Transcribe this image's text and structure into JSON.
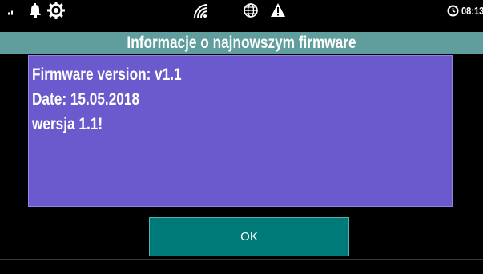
{
  "status_bar": {
    "time": "08:13",
    "icons": [
      "signal-dots-icon",
      "bell-icon",
      "gear-icon",
      "wifi-icon",
      "globe-icon",
      "warning-icon",
      "clock-icon"
    ]
  },
  "dialog": {
    "title": "Informacje o najnowszym firmware",
    "lines": [
      "Firmware version: v1.1",
      "Date: 15.05.2018",
      "wersja 1.1!"
    ],
    "ok_label": "OK"
  },
  "colors": {
    "background": "#000000",
    "title_bar": "#5f9e9c",
    "message_panel": "#6a5acd",
    "ok_button": "#007a78",
    "text": "#ffffff"
  }
}
